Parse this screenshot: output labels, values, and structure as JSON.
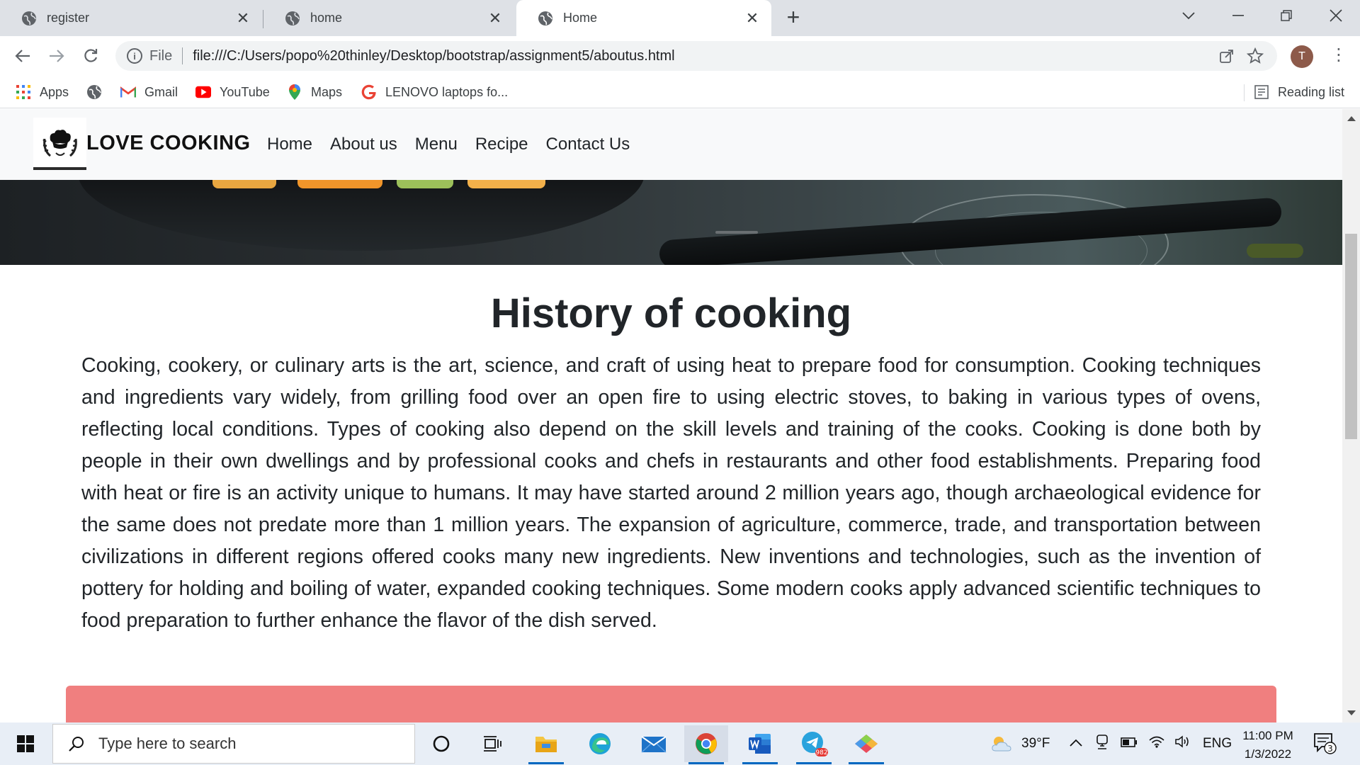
{
  "browser": {
    "tabs": [
      {
        "title": "register",
        "active": false
      },
      {
        "title": "home",
        "active": false
      },
      {
        "title": "Home",
        "active": true
      }
    ],
    "address": {
      "scheme_label": "File",
      "url": "file:///C:/Users/popo%20thinley/Desktop/bootstrap/assignment5/aboutus.html"
    },
    "profile_initial": "T",
    "bookmarks": [
      {
        "label": "Apps",
        "icon": "apps-grid-icon"
      },
      {
        "label": "",
        "icon": "globe-icon"
      },
      {
        "label": "Gmail",
        "icon": "gmail-icon"
      },
      {
        "label": "YouTube",
        "icon": "youtube-icon"
      },
      {
        "label": "Maps",
        "icon": "maps-icon"
      },
      {
        "label": "LENOVO laptops fo...",
        "icon": "google-icon"
      }
    ],
    "reading_list": "Reading list"
  },
  "page": {
    "brand": "LOVE COOKING",
    "nav": [
      "Home",
      "About us",
      "Menu",
      "Recipe",
      "Contact Us"
    ],
    "title": "History of cooking",
    "body": "Cooking, cookery, or culinary arts is the art, science, and craft of using heat to prepare food for consumption. Cooking techniques and ingredients vary widely, from grilling food over an open fire to using electric stoves, to baking in various types of ovens, reflecting local conditions. Types of cooking also depend on the skill levels and training of the cooks. Cooking is done both by people in their own dwellings and by professional cooks and chefs in restaurants and other food establishments. Preparing food with heat or fire is an activity unique to humans. It may have started around 2 million years ago, though archaeological evidence for the same does not predate more than 1 million years. The expansion of agriculture, commerce, trade, and transportation between civilizations in different regions offered cooks many new ingredients. New inventions and technologies, such as the invention of pottery for holding and boiling of water, expanded cooking techniques. Some modern cooks apply advanced scientific techniques to food preparation to further enhance the flavor of the dish served.",
    "accent_box_color": "#f07f7f"
  },
  "taskbar": {
    "search_placeholder": "Type here to search",
    "apps": [
      "cortana-icon",
      "task-view-icon",
      "file-explorer-icon",
      "edge-icon",
      "mail-icon",
      "chrome-icon",
      "word-icon",
      "telegram-icon",
      "app-icon"
    ],
    "telegram_badge": "982",
    "weather": "39°F",
    "language": "ENG",
    "time": "11:00 PM",
    "date": "1/3/2022",
    "notifications": "3"
  }
}
